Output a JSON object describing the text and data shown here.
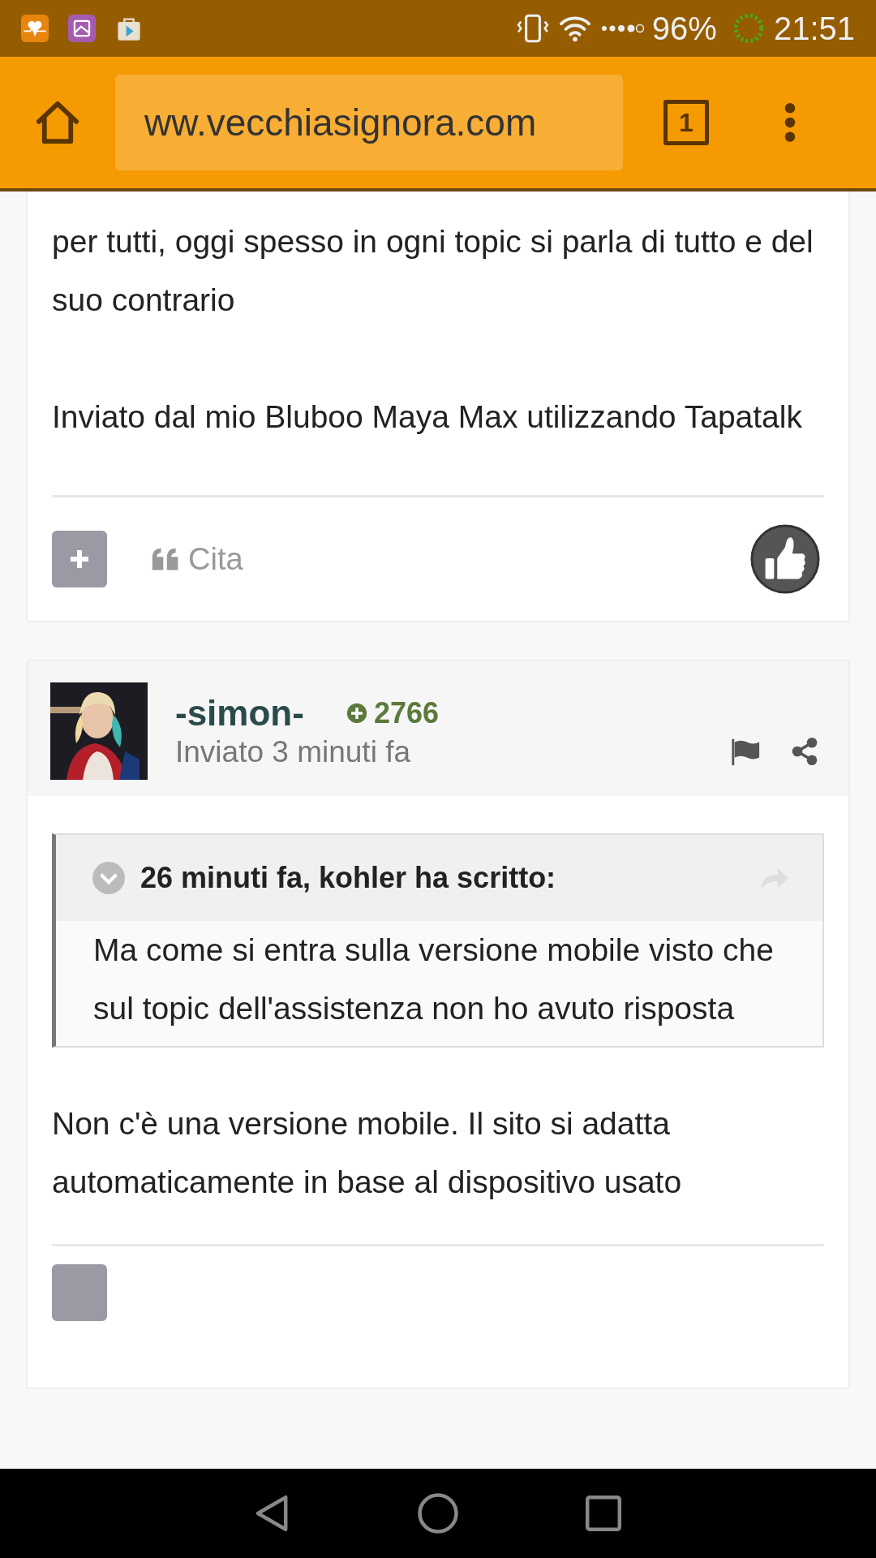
{
  "status_bar": {
    "battery": "96%",
    "time": "21:51"
  },
  "browser": {
    "url": "ww.vecchiasignora.com",
    "tab_count": "1"
  },
  "posts": [
    {
      "kind": "continued",
      "body": [
        "per tutti, oggi spesso in ogni topic si parla di tutto e del suo contrario",
        "Inviato dal mio Bluboo Maya Max utilizzando Tapatalk"
      ],
      "quote_action": "Cita"
    },
    {
      "kind": "full",
      "author": "-simon-",
      "reputation": "2766",
      "time": "Inviato 3 minuti fa",
      "quote": {
        "header": "26 minuti fa, kohler ha scritto:",
        "text": "Ma come si entra sulla versione mobile visto che sul topic dell'assistenza non ho avuto risposta"
      },
      "body": [
        "Non c'è una versione mobile. Il sito si adatta automaticamente in base al dispositivo usato"
      ]
    }
  ]
}
